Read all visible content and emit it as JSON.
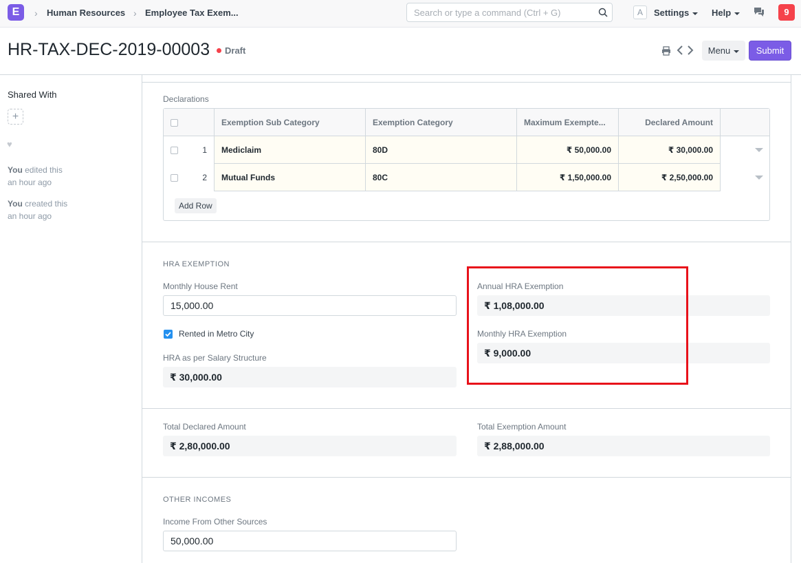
{
  "navbar": {
    "logo_letter": "E",
    "breadcrumbs": [
      "Human Resources",
      "Employee Tax Exem..."
    ],
    "search_placeholder": "Search or type a command (Ctrl + G)",
    "avatar_letter": "A",
    "settings_label": "Settings",
    "help_label": "Help",
    "notification_count": "9"
  },
  "page": {
    "title": "HR-TAX-DEC-2019-00003",
    "status": "Draft",
    "status_color": "#f5424b",
    "menu_label": "Menu",
    "submit_label": "Submit"
  },
  "sidebar": {
    "shared_with_label": "Shared With",
    "activity": [
      {
        "who": "You",
        "action": "edited this",
        "when": "an hour ago"
      },
      {
        "who": "You",
        "action": "created this",
        "when": "an hour ago"
      }
    ]
  },
  "declarations": {
    "label": "Declarations",
    "columns": [
      "Exemption Sub Category",
      "Exemption Category",
      "Maximum Exempte...",
      "Declared Amount"
    ],
    "rows": [
      {
        "idx": "1",
        "sub_category": "Mediclaim",
        "category": "80D",
        "max_exempted": "₹ 50,000.00",
        "declared": "₹ 30,000.00"
      },
      {
        "idx": "2",
        "sub_category": "Mutual Funds",
        "category": "80C",
        "max_exempted": "₹ 1,50,000.00",
        "declared": "₹ 2,50,000.00"
      }
    ],
    "add_row_label": "Add Row"
  },
  "hra": {
    "heading": "HRA EXEMPTION",
    "monthly_rent_label": "Monthly House Rent",
    "monthly_rent_value": "15,000.00",
    "metro_label": "Rented in Metro City",
    "metro_checked": true,
    "salary_structure_label": "HRA as per Salary Structure",
    "salary_structure_value": "₹ 30,000.00",
    "annual_label": "Annual HRA Exemption",
    "annual_value": "₹ 1,08,000.00",
    "monthly_label": "Monthly HRA Exemption",
    "monthly_value": "₹ 9,000.00"
  },
  "totals": {
    "declared_label": "Total Declared Amount",
    "declared_value": "₹ 2,80,000.00",
    "exemption_label": "Total Exemption Amount",
    "exemption_value": "₹ 2,88,000.00"
  },
  "other_incomes": {
    "heading": "OTHER INCOMES",
    "income_label": "Income From Other Sources",
    "income_value": "50,000.00"
  },
  "colors": {
    "accent": "#7b5ce6",
    "highlight": "#e8111a",
    "checkbox": "#2490ef"
  }
}
